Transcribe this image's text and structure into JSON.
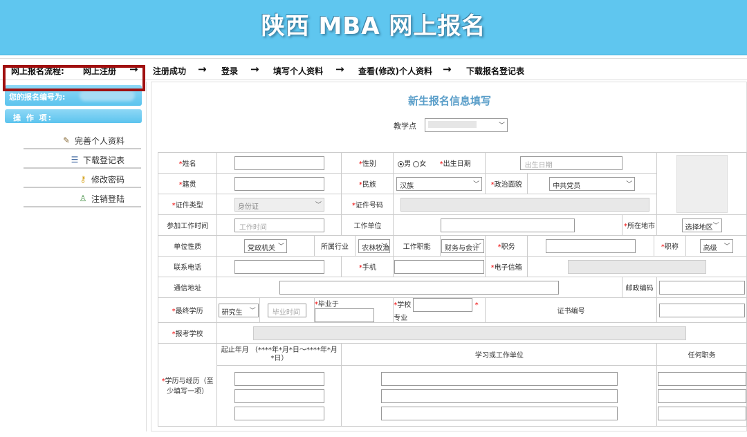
{
  "header": {
    "title": "陕西 MBA 网上报名"
  },
  "flow": {
    "label": "网上报名流程:",
    "steps": [
      "网上注册",
      "注册成功",
      "登录",
      "填写个人资料",
      "查看(修改)个人资料",
      "下载报名登记表"
    ],
    "arrow": "→"
  },
  "sidebar": {
    "reg_number_label": "您的报名编号为:",
    "ops_label": "操 作 项:",
    "links": [
      "完善个人资料",
      "下载登记表",
      "修改密码",
      "注销登陆"
    ]
  },
  "main": {
    "form_title": "新生报名信息填写",
    "teaching_point_label": "教学点"
  },
  "form": {
    "name_label": "姓名",
    "gender_label": "性别",
    "gender_male": "男",
    "gender_female": "女",
    "birth_label": "出生日期",
    "birth_placeholder": "出生日期",
    "native_label": "籍贯",
    "ethnic_label": "民族",
    "ethnic_value": "汉族",
    "political_label": "政治面貌",
    "political_value": "中共党员",
    "id_type_label": "证件类型",
    "id_type_value": "身份证",
    "id_number_label": "证件号码",
    "work_start_label": "参加工作时间",
    "work_start_placeholder": "工作时间",
    "work_unit_label": "工作单位",
    "location_label": "所在地市",
    "location_value": "选择地区",
    "unit_nature_label": "单位性质",
    "unit_nature_value": "党政机关",
    "industry_label": "所属行业",
    "industry_value": "农林牧渔",
    "job_function_label": "工作职能",
    "job_function_value": "财务与会计",
    "position_label": "职务",
    "title_label": "职称",
    "title_value": "高级",
    "phone_label": "联系电话",
    "mobile_label": "手机",
    "email_label": "电子信箱",
    "address_label": "通信地址",
    "postcode_label": "邮政编码",
    "education_label": "最终学历",
    "education_value": "研究生",
    "grad_time_placeholder": "毕业时间",
    "grad_at_label": "毕业于",
    "school_label": "学校",
    "major_label": "专业",
    "cert_no_label": "证书编号",
    "apply_school_label": "报考学校",
    "history_label": "学历与经历（至少填写一项）",
    "period_header": "起止年月 （****年*月*日～****年*月*日）",
    "unit_header": "学习或工作单位",
    "role_header": "任何职务"
  }
}
